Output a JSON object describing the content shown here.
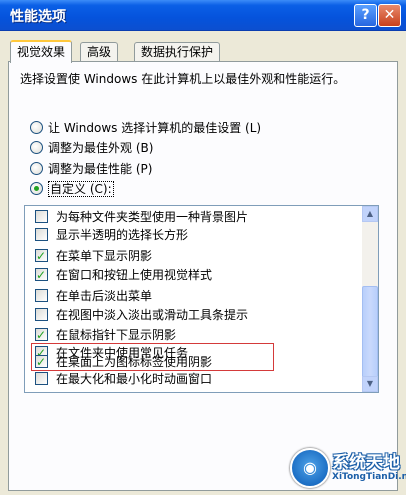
{
  "window": {
    "title": "性能选项",
    "help_glyph": "?",
    "close_glyph": "✕"
  },
  "tabs": [
    {
      "label": "视觉效果",
      "active": true
    },
    {
      "label": "高级",
      "active": false
    },
    {
      "label": "数据执行保护",
      "active": false
    }
  ],
  "description": "选择设置使 Windows 在此计算机上以最佳外观和性能运行。",
  "radios": [
    {
      "label": "让 Windows 选择计算机的最佳设置",
      "hotkey": "(L)",
      "checked": false
    },
    {
      "label": "调整为最佳外观",
      "hotkey": "(B)",
      "checked": false
    },
    {
      "label": "调整为最佳性能",
      "hotkey": "(P)",
      "checked": false
    },
    {
      "label": "自定义",
      "hotkey": "(C)",
      "checked": true,
      "suffix": ":"
    }
  ],
  "options": [
    {
      "label": "为每种文件夹类型使用一种背景图片",
      "checked": false
    },
    {
      "label": "显示半透明的选择长方形",
      "checked": false
    },
    {
      "label": "在菜单下显示阴影",
      "checked": true
    },
    {
      "label": "在窗口和按钮上使用视觉样式",
      "checked": true
    },
    {
      "label": "在单击后淡出菜单",
      "checked": false
    },
    {
      "label": "在视图中淡入淡出或滑动工具条提示",
      "checked": false
    },
    {
      "label": "在鼠标指针下显示阴影",
      "checked": true
    },
    {
      "label": "在文件夹中使用常见任务",
      "checked": true
    },
    {
      "label": "在桌面上为图标标签使用阴影",
      "checked": true
    },
    {
      "label": "在最大化和最小化时动画窗口",
      "checked": false
    }
  ],
  "scrollbar": {
    "up_glyph": "▲",
    "down_glyph": "▼"
  },
  "watermark": {
    "name": "系统天地",
    "url": "XiTongTianDi.net"
  },
  "colors": {
    "title_bar": "#0553DC",
    "highlight_box": "#D43A3A",
    "check": "#21A121"
  }
}
